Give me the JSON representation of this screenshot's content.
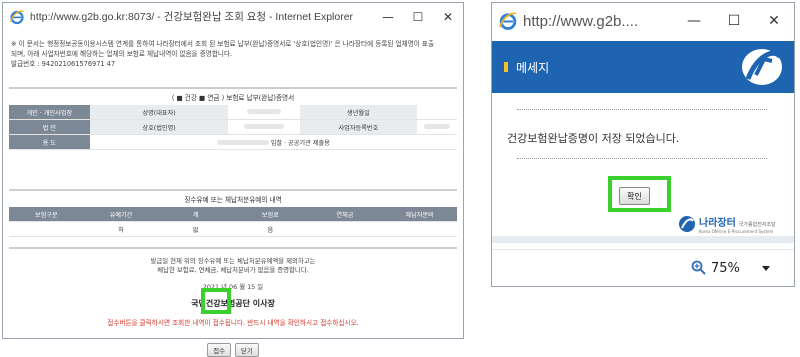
{
  "window1": {
    "title": "http://www.g2b.go.kr:8073/ - 건강보험완납 조회 요청 - Internet Explorer",
    "notice_line1": "※ 이 문서는 행정정보공동이용시스템 연계를 통하여 나라장터에서 조회 된 보험료 납부(완납)증명서로 '상호(법인명)' 은 나라장터에 등록된 업체명이 표출",
    "notice_line2": "되며, 아래 사업자번호에 해당하는 업체의 보험료 체납내역이 없음을 증명합니다.",
    "notice_line3": "발급번호 : 942021061576971 47",
    "cert_title": "( ■ 건강 ■ 연금 ) 보험료 납부(완납)증명서",
    "row1": {
      "c1": "개인 · 개인사업장",
      "c2": "성명(대표자)",
      "c3": "생년월일"
    },
    "row2": {
      "c1": "법 인",
      "c2": "상호(법인명)",
      "c3": "사업자등록번호"
    },
    "row3": {
      "c1": "용 도",
      "value": "입찰 · 공공기관 제출용"
    },
    "arrears_title": "징수유예 또는 체납처분유예의 내역",
    "arrears_headers": [
      "보험구분",
      "유예기간",
      "계",
      "보험료",
      "연체금",
      "체납처분비"
    ],
    "arrears_row": [
      "",
      "허",
      "없",
      "음",
      "",
      ""
    ],
    "body_line1": "발급일 현재 위의 징수유예 또는 체납처분유예액을 제외하고는",
    "body_line2": "체납한 보험료, 연체금, 체납처분비가 없음을 증명합니다.",
    "date": "2021 년 06 월 15 일",
    "issuer": "국민건강보험공단 이사장",
    "red_notice": "접수버튼을 클릭하시면 조회한 내역이 접수됩니다. 반드시 내역을 확인하시고 접수하십시오.",
    "btn_receive": "접수",
    "btn_close": "닫기",
    "min": "—",
    "max": "☐",
    "close": "✕"
  },
  "window2": {
    "title": "http://www.g2b....",
    "header_label": "메세지",
    "message": "건강보험완납증명이 저장 되었습니다.",
    "ok_button": "확인",
    "brand_name": "나라장터",
    "brand_sub": "국가종합전자조달",
    "brand_en": "Korea ON-line E-Procurement System",
    "zoom": "75%",
    "min": "—",
    "max": "☐",
    "close": "✕"
  },
  "colors": {
    "highlight": "#3bd12c",
    "header_blue": "#1f64b0",
    "table_head": "#7d8896",
    "warning_red": "#d23a2d"
  }
}
